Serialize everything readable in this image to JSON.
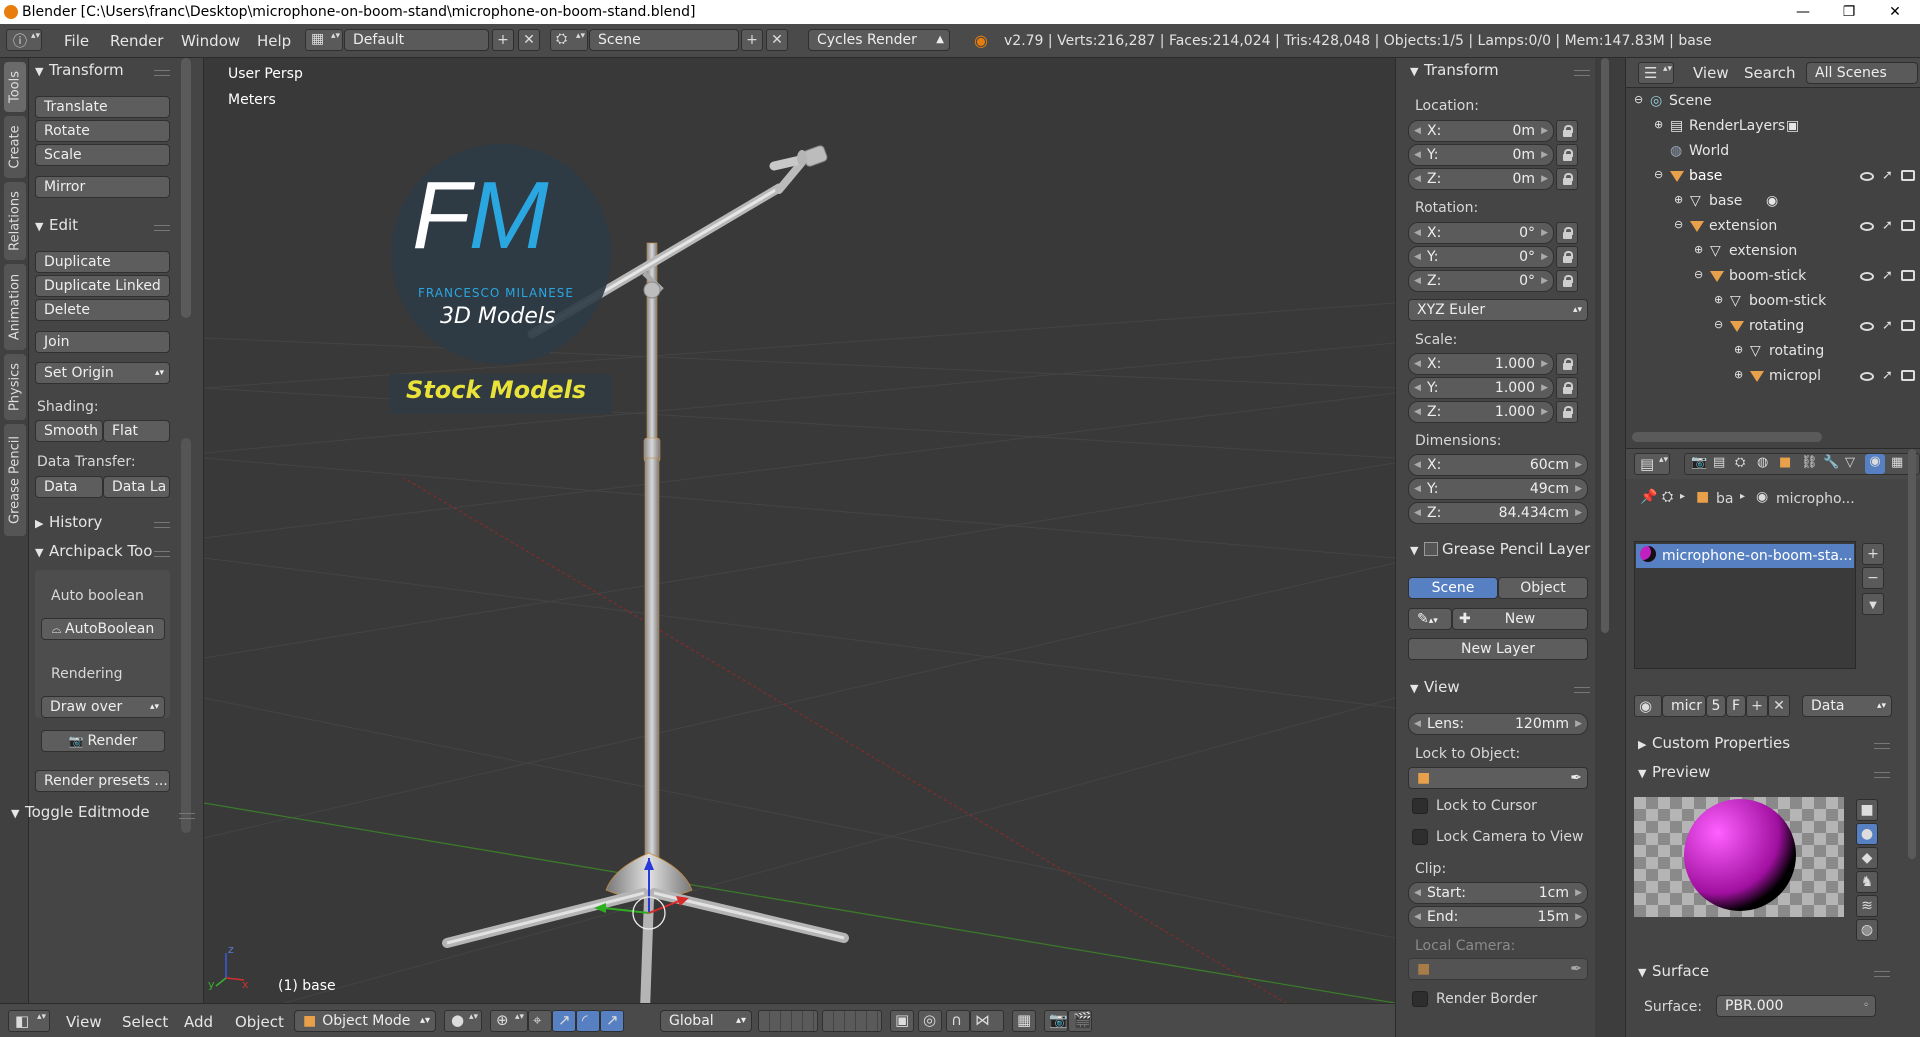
{
  "window": {
    "title": "Blender [C:\\Users\\franc\\Desktop\\microphone-on-boom-stand\\microphone-on-boom-stand.blend]",
    "minimize": "—",
    "maximize": "❐",
    "close": "✕"
  },
  "menubar": {
    "menus": [
      "File",
      "Render",
      "Window",
      "Help"
    ],
    "layout": "Default",
    "scene": "Scene",
    "engine": "Cycles Render",
    "stats": "v2.79 | Verts:216,287 | Faces:214,024 | Tris:428,048 | Objects:1/5 | Lamps:0/0 | Mem:147.83M | base"
  },
  "tabs": [
    "Tools",
    "Create",
    "Relations",
    "Animation",
    "Physics",
    "Grease Pencil"
  ],
  "toolshelf": {
    "transform_title": "Transform",
    "translate": "Translate",
    "rotate": "Rotate",
    "scale": "Scale",
    "mirror": "Mirror",
    "edit_title": "Edit",
    "duplicate": "Duplicate",
    "duplicate_linked": "Duplicate Linked",
    "delete": "Delete",
    "join": "Join",
    "set_origin": "Set Origin",
    "shading_label": "Shading:",
    "smooth": "Smooth",
    "flat": "Flat",
    "data_transfer_label": "Data Transfer:",
    "data": "Data",
    "data_la": "Data La",
    "history_title": "History",
    "archipack_title": "Archipack Too",
    "auto_boolean_label": "Auto boolean",
    "autoboolean_btn": "AutoBoolean",
    "rendering_label": "Rendering",
    "draw_over": "Draw over",
    "render_btn": "Render",
    "render_presets": "Render presets ...",
    "toggle_editmode": "Toggle Editmode"
  },
  "viewport": {
    "view_name": "User Persp",
    "units": "Meters",
    "object_label": "(1) base",
    "logo": {
      "big": "FM",
      "name": "FRANCESCO MILANESE",
      "sub": "3D Models",
      "banner": "Stock Models",
      "brand_blue": "#2aa7e0",
      "brand_yellow": "#e8e23a"
    }
  },
  "npanel": {
    "transform_title": "Transform",
    "location_label": "Location:",
    "location": [
      {
        "k": "X:",
        "v": "0m"
      },
      {
        "k": "Y:",
        "v": "0m"
      },
      {
        "k": "Z:",
        "v": "0m"
      }
    ],
    "rotation_label": "Rotation:",
    "rotation": [
      {
        "k": "X:",
        "v": "0°"
      },
      {
        "k": "Y:",
        "v": "0°"
      },
      {
        "k": "Z:",
        "v": "0°"
      }
    ],
    "rotation_mode": "XYZ Euler",
    "scale_label": "Scale:",
    "scale": [
      {
        "k": "X:",
        "v": "1.000"
      },
      {
        "k": "Y:",
        "v": "1.000"
      },
      {
        "k": "Z:",
        "v": "1.000"
      }
    ],
    "dimensions_label": "Dimensions:",
    "dimensions": [
      {
        "k": "X:",
        "v": "60cm"
      },
      {
        "k": "Y:",
        "v": "49cm"
      },
      {
        "k": "Z:",
        "v": "84.434cm"
      }
    ],
    "gp_title": "Grease Pencil Layer",
    "gp_scene": "Scene",
    "gp_object": "Object",
    "gp_new": "New",
    "gp_new_layer": "New Layer",
    "view_title": "View",
    "lens_label": "Lens:",
    "lens_value": "120mm",
    "lock_to_object_label": "Lock to Object:",
    "lock_to_cursor": "Lock to Cursor",
    "lock_camera_to_view": "Lock Camera to View",
    "clip_label": "Clip:",
    "clip_start_label": "Start:",
    "clip_start": "1cm",
    "clip_end_label": "End:",
    "clip_end": "15m",
    "local_camera_label": "Local Camera:",
    "render_border": "Render Border"
  },
  "outliner": {
    "view": "View",
    "search": "Search",
    "all_scenes": "All Scenes",
    "items": [
      "Scene",
      "RenderLayers",
      "World",
      "base",
      "base",
      "extension",
      "extension",
      "boom-stick",
      "boom-stick",
      "rotating",
      "rotating",
      "micropl"
    ]
  },
  "properties": {
    "breadcrumb_object": "ba",
    "breadcrumb_material": "micropho...",
    "material_slot": "microphone-on-boom-sta...",
    "material_name": "micr",
    "users": "5",
    "fake": "F",
    "link": "Data",
    "custom_properties": "Custom Properties",
    "preview": "Preview",
    "surface_title": "Surface",
    "surface_label": "Surface:",
    "surface_value": "PBR.000"
  },
  "bottombar": {
    "menus": [
      "View",
      "Select",
      "Add",
      "Object"
    ],
    "mode": "Object Mode",
    "orientation": "Global"
  }
}
